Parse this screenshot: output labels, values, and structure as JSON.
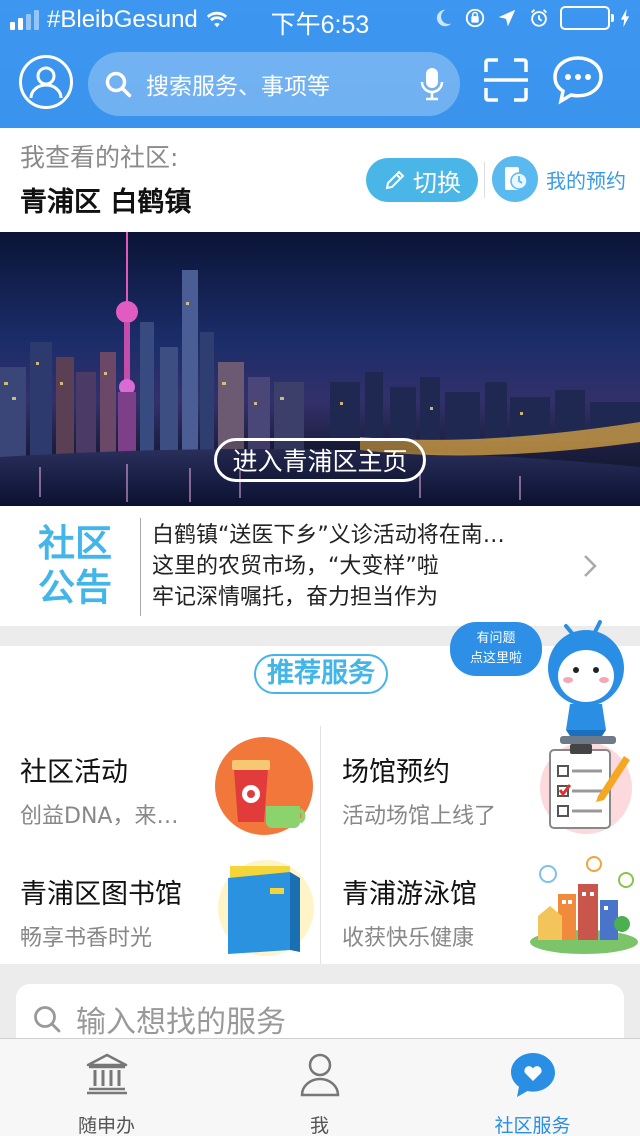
{
  "status_bar": {
    "carrier": "#BleibGesund",
    "time": "下午6:53",
    "signal_bars": 4,
    "signal_active": 2,
    "battery_color": "#4cd964"
  },
  "header": {
    "search_placeholder": "搜索服务、事项等",
    "icons": [
      "user-avatar-icon",
      "search-icon",
      "microphone-icon",
      "scan-icon",
      "chat-icon"
    ],
    "background": "#3d97f0"
  },
  "community": {
    "label": "我查看的社区:",
    "name": "青浦区 白鹤镇",
    "switch_label": "切换",
    "reservation_label": "我的预约"
  },
  "banner": {
    "button_label": "进入青浦区主页"
  },
  "notice": {
    "tag_line1": "社区",
    "tag_line2": "公告",
    "items": [
      "白鹤镇“送医下乡”义诊活动将在南…",
      "这里的农贸市场，“大变样”啦",
      "牢记深情嘱托，奋力担当作为"
    ]
  },
  "recommended": {
    "title": "推荐服务",
    "bubble_line1": "有问题",
    "bubble_line2": "点这里啦",
    "services": [
      {
        "title": "社区活动",
        "subtitle": "创益DNA，来…",
        "icon": "coffee-cup-icon"
      },
      {
        "title": "场馆预约",
        "subtitle": "活动场馆上线了",
        "icon": "checklist-icon"
      },
      {
        "title": "青浦区图书馆",
        "subtitle": "畅享书香时光",
        "icon": "book-icon"
      },
      {
        "title": "青浦游泳馆",
        "subtitle": "收获快乐健康",
        "icon": "town-buildings-icon"
      }
    ]
  },
  "bottom_search": {
    "placeholder": "输入想找的服务"
  },
  "tabbar": {
    "tabs": [
      {
        "label": "随申办",
        "icon": "government-building-icon",
        "active": false
      },
      {
        "label": "我",
        "icon": "person-icon",
        "active": false
      },
      {
        "label": "社区服务",
        "icon": "heart-chat-icon",
        "active": true
      }
    ],
    "active_color": "#2a8fe4"
  }
}
